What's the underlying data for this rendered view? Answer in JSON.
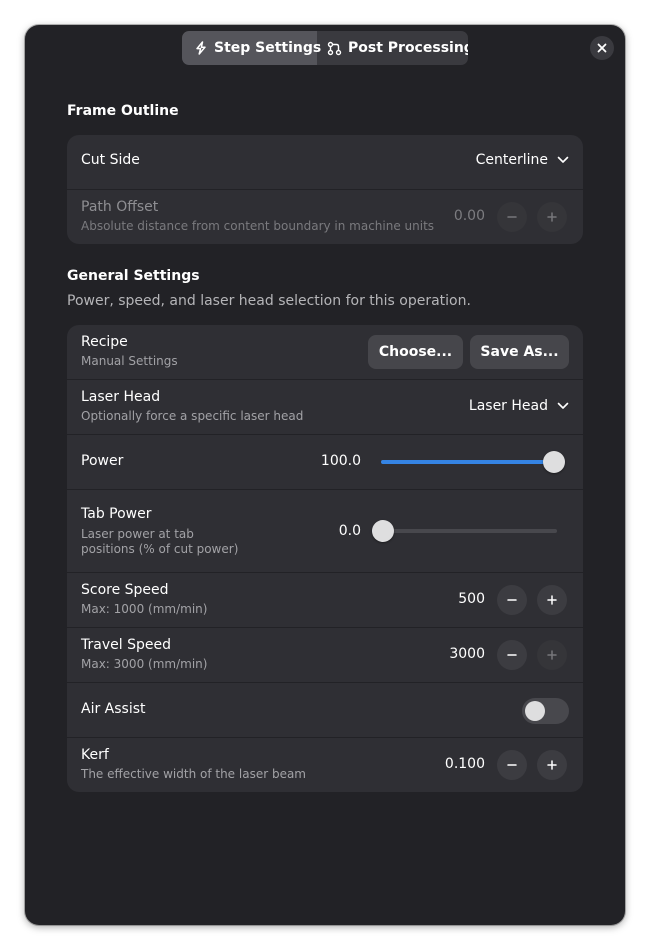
{
  "header": {
    "tabs": [
      {
        "label": "Step Settings",
        "icon": "lightning-icon",
        "active": true
      },
      {
        "label": "Post Processing",
        "icon": "nodes-icon",
        "active": false
      }
    ],
    "close_icon": "close-icon"
  },
  "frame_outline": {
    "title": "Frame Outline",
    "cut_side": {
      "label": "Cut Side",
      "value": "Centerline"
    },
    "path_offset": {
      "label": "Path Offset",
      "subtitle": "Absolute distance from content boundary in machine units",
      "value": "0.00",
      "enabled": false
    }
  },
  "general": {
    "title": "General Settings",
    "description": "Power, speed, and laser head selection for this operation.",
    "recipe": {
      "label": "Recipe",
      "subtitle": "Manual Settings",
      "choose_label": "Choose...",
      "save_as_label": "Save As..."
    },
    "laser_head": {
      "label": "Laser Head",
      "subtitle": "Optionally force a specific laser head",
      "value": "Laser Head"
    },
    "power": {
      "label": "Power",
      "value": "100.0",
      "fraction": 1.0
    },
    "tab_power": {
      "label": "Tab Power",
      "subtitle_line1": "Laser power at tab",
      "subtitle_line2": "positions (% of cut power)",
      "value": "0.0",
      "fraction": 0.0
    },
    "score_speed": {
      "label": "Score Speed",
      "subtitle": "Max: 1000 (mm/min)",
      "value": "500"
    },
    "travel_speed": {
      "label": "Travel Speed",
      "subtitle": "Max: 3000 (mm/min)",
      "value": "3000",
      "plus_enabled": false
    },
    "air_assist": {
      "label": "Air Assist",
      "enabled": false
    },
    "kerf": {
      "label": "Kerf",
      "subtitle": "The effective width of the laser beam",
      "value": "0.100"
    }
  },
  "colors": {
    "accent": "#3584e4",
    "window_bg": "#222226",
    "card_bg": "#2f2f34"
  }
}
